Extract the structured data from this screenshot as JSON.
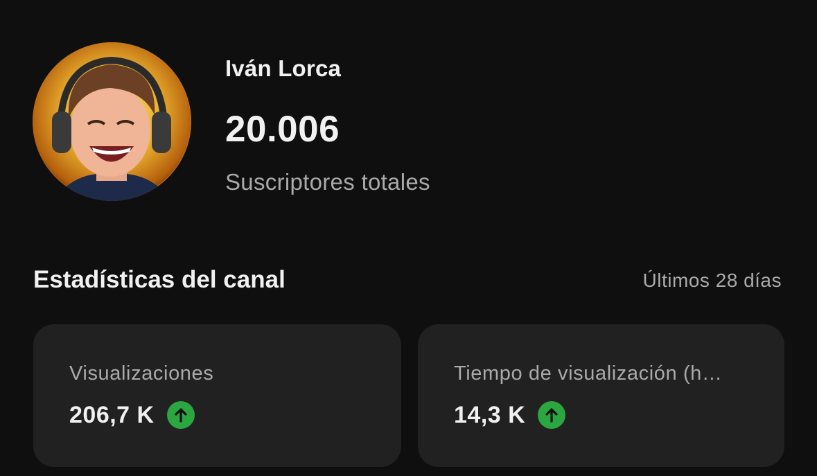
{
  "channel": {
    "name": "Iván Lorca",
    "subscriber_count": "20.006",
    "subscriber_label": "Suscriptores totales",
    "avatar_icon": "channel-avatar"
  },
  "stats": {
    "title": "Estadísticas del canal",
    "period": "Últimos 28 días",
    "cards": [
      {
        "label": "Visualizaciones",
        "value": "206,7 K",
        "trend_icon": "arrow-up-icon"
      },
      {
        "label": "Tiempo de visualización (h…",
        "value": "14,3 K",
        "trend_icon": "arrow-up-icon"
      }
    ]
  },
  "colors": {
    "background": "#0f0f0f",
    "card": "#212121",
    "primary_text": "#f1f1f1",
    "secondary_text": "#aaaaaa",
    "trend_up": "#2ba640"
  }
}
